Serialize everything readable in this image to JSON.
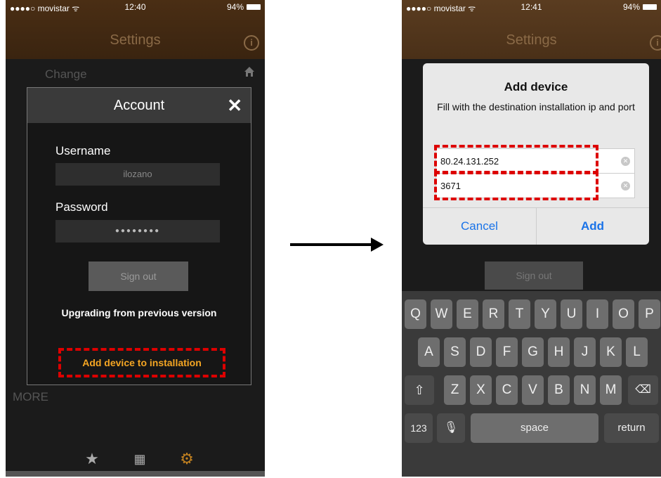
{
  "left": {
    "status": {
      "carrier": "●●●●○ movistar ᯤ",
      "time": "12:40",
      "battery": "94%"
    },
    "nav_title": "Settings",
    "bg_change": "Change",
    "bg_more": "MORE",
    "modal": {
      "title": "Account",
      "username_label": "Username",
      "username_value": "ilozano",
      "password_label": "Password",
      "password_value": "●●●●●●●●",
      "signout": "Sign out",
      "upgrading": "Upgrading from previous version",
      "add_device": "Add device to installation"
    }
  },
  "right": {
    "status": {
      "carrier": "●●●●○ movistar ᯤ",
      "time": "12:41",
      "battery": "94%"
    },
    "nav_title": "Settings",
    "signout": "Sign out",
    "alert": {
      "title": "Add device",
      "message": "Fill with the destination installation ip and port",
      "ip_value": "80.24.131.252",
      "port_value": "3671",
      "cancel": "Cancel",
      "add": "Add"
    },
    "keyboard": {
      "row1": [
        "Q",
        "W",
        "E",
        "R",
        "T",
        "Y",
        "U",
        "I",
        "O",
        "P"
      ],
      "row2": [
        "A",
        "S",
        "D",
        "F",
        "G",
        "H",
        "J",
        "K",
        "L"
      ],
      "row3": [
        "Z",
        "X",
        "C",
        "V",
        "B",
        "N",
        "M"
      ],
      "numbers": "123",
      "space": "space",
      "return": "return"
    }
  },
  "colors": {
    "accent_red": "#dd0000",
    "orange": "#f5a623",
    "ios_blue": "#1a73e8"
  }
}
